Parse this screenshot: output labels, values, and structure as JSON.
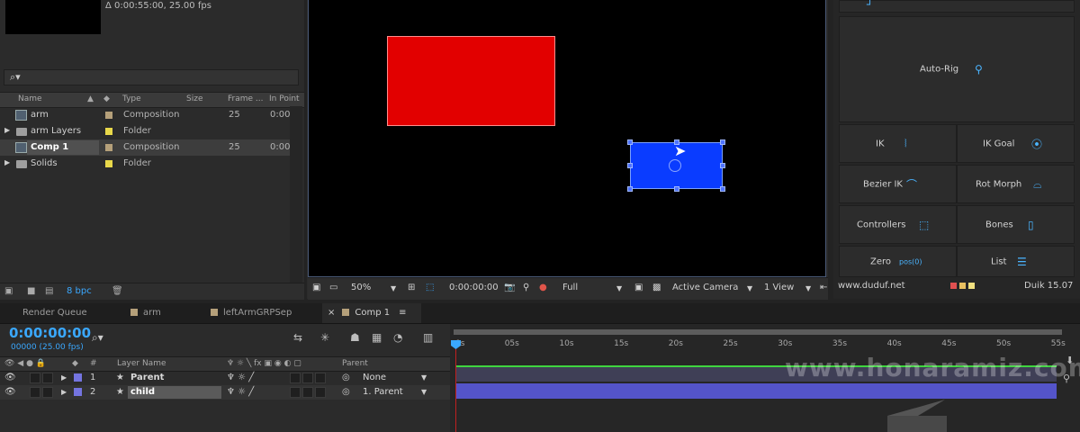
{
  "project": {
    "info": "Δ 0:00:55:00, 25.00 fps",
    "search_icon": "search-icon",
    "columns": {
      "name": "Name",
      "type": "Type",
      "size": "Size",
      "frame": "Frame ...",
      "in_point": "In Point"
    },
    "items": [
      {
        "name": "arm",
        "type": "Composition",
        "frame": "25",
        "in_point": "0:00",
        "kind": "comp",
        "color": "#b5a07a"
      },
      {
        "name": "arm Layers",
        "type": "Folder",
        "frame": "",
        "in_point": "",
        "kind": "folder",
        "color": "#e8d84a"
      },
      {
        "name": "Comp 1",
        "type": "Composition",
        "frame": "25",
        "in_point": "0:00",
        "kind": "comp",
        "color": "#b5a07a"
      },
      {
        "name": "Solids",
        "type": "Folder",
        "frame": "",
        "in_point": "",
        "kind": "folder",
        "color": "#e8d84a"
      }
    ],
    "bpc": "8 bpc"
  },
  "viewer": {
    "zoom": "50%",
    "timecode": "0:00:00:00",
    "resolution": "Full",
    "camera": "Active Camera",
    "view": "1 View"
  },
  "duik": {
    "autorig": "Auto-Rig",
    "ik": "IK",
    "ik_goal": "IK Goal",
    "bezier_ik": "Bezier IK",
    "rot_morph": "Rot Morph",
    "controllers": "Controllers",
    "bones": "Bones",
    "zero": "Zero",
    "zero_sub": "pos(0)",
    "list": "List",
    "site": "www.duduf.net",
    "version": "Duik 15.07"
  },
  "tabs": {
    "render_queue": "Render Queue",
    "arm": "arm",
    "left_arm": "leftArmGRPSep",
    "comp1": "Comp 1"
  },
  "timeline": {
    "timecode": "0:00:00:00",
    "timecode_sub": "00000 (25.00 fps)",
    "columns": {
      "num": "#",
      "layer_name": "Layer Name",
      "parent": "Parent"
    },
    "layers": [
      {
        "num": "1",
        "name": "Parent",
        "parent": "None"
      },
      {
        "num": "2",
        "name": "child",
        "parent": "1. Parent"
      }
    ],
    "ruler": [
      "0s",
      "05s",
      "10s",
      "15s",
      "20s",
      "25s",
      "30s",
      "35s",
      "40s",
      "45s",
      "50s",
      "55s"
    ]
  },
  "watermark": "www.honaramiz.com"
}
